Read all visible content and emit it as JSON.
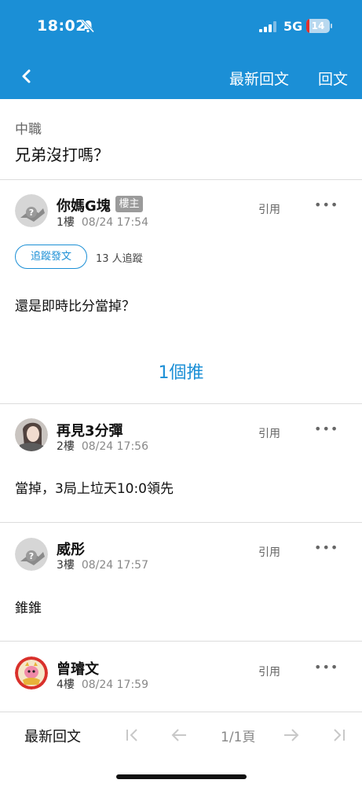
{
  "status": {
    "time": "18:02",
    "network": "5G",
    "battery": "14",
    "battery_level": 0.14
  },
  "header": {
    "latest_reply": "最新回文",
    "reply": "回文"
  },
  "thread": {
    "board": "中職",
    "title": "兄弟沒打嗎？"
  },
  "posts": [
    {
      "name": "你媽G塊",
      "badge": "樓主",
      "floor": "1樓",
      "time": "08/24 17:54",
      "quote": "引用",
      "more": "•••",
      "content": "還是即時比分當掉？"
    },
    {
      "name": "再見3分彈",
      "floor": "2樓",
      "time": "08/24 17:56",
      "quote": "引用",
      "more": "•••",
      "content": "當掉，3局上垃天10:0領先"
    },
    {
      "name": "威彤",
      "floor": "3樓",
      "time": "08/24 17:57",
      "quote": "引用",
      "more": "•••",
      "content": "錐錐"
    },
    {
      "name": "曾璿文",
      "floor": "4樓",
      "time": "08/24 17:59",
      "quote": "引用",
      "more": "•••"
    }
  ],
  "follow": {
    "button": "追蹤發文",
    "count_text": "13 人追蹤"
  },
  "push": {
    "text": "1個推"
  },
  "bottom": {
    "latest_reply": "最新回文",
    "page": "1/1頁"
  },
  "colors": {
    "accent": "#1b8fd6",
    "badge": "#9b9b9b",
    "battery_low": "#e0312d"
  }
}
